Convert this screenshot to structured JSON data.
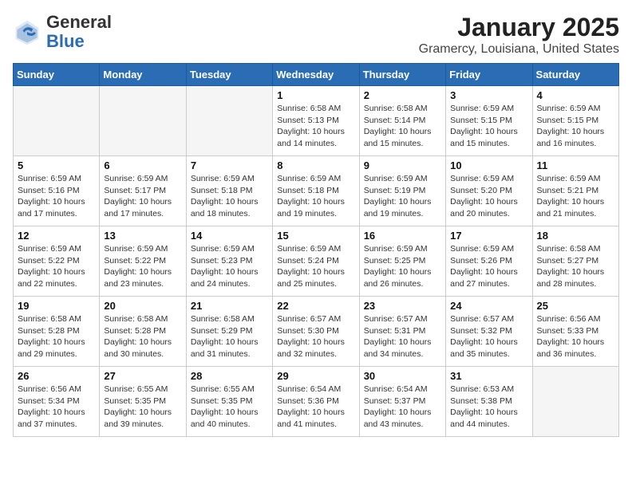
{
  "logo": {
    "general": "General",
    "blue": "Blue"
  },
  "title": "January 2025",
  "subtitle": "Gramercy, Louisiana, United States",
  "days_of_week": [
    "Sunday",
    "Monday",
    "Tuesday",
    "Wednesday",
    "Thursday",
    "Friday",
    "Saturday"
  ],
  "weeks": [
    [
      {
        "day": null,
        "info": null
      },
      {
        "day": null,
        "info": null
      },
      {
        "day": null,
        "info": null
      },
      {
        "day": "1",
        "sunrise": "6:58 AM",
        "sunset": "5:13 PM",
        "daylight": "10 hours and 14 minutes."
      },
      {
        "day": "2",
        "sunrise": "6:58 AM",
        "sunset": "5:14 PM",
        "daylight": "10 hours and 15 minutes."
      },
      {
        "day": "3",
        "sunrise": "6:59 AM",
        "sunset": "5:15 PM",
        "daylight": "10 hours and 15 minutes."
      },
      {
        "day": "4",
        "sunrise": "6:59 AM",
        "sunset": "5:15 PM",
        "daylight": "10 hours and 16 minutes."
      }
    ],
    [
      {
        "day": "5",
        "sunrise": "6:59 AM",
        "sunset": "5:16 PM",
        "daylight": "10 hours and 17 minutes."
      },
      {
        "day": "6",
        "sunrise": "6:59 AM",
        "sunset": "5:17 PM",
        "daylight": "10 hours and 17 minutes."
      },
      {
        "day": "7",
        "sunrise": "6:59 AM",
        "sunset": "5:18 PM",
        "daylight": "10 hours and 18 minutes."
      },
      {
        "day": "8",
        "sunrise": "6:59 AM",
        "sunset": "5:18 PM",
        "daylight": "10 hours and 19 minutes."
      },
      {
        "day": "9",
        "sunrise": "6:59 AM",
        "sunset": "5:19 PM",
        "daylight": "10 hours and 19 minutes."
      },
      {
        "day": "10",
        "sunrise": "6:59 AM",
        "sunset": "5:20 PM",
        "daylight": "10 hours and 20 minutes."
      },
      {
        "day": "11",
        "sunrise": "6:59 AM",
        "sunset": "5:21 PM",
        "daylight": "10 hours and 21 minutes."
      }
    ],
    [
      {
        "day": "12",
        "sunrise": "6:59 AM",
        "sunset": "5:22 PM",
        "daylight": "10 hours and 22 minutes."
      },
      {
        "day": "13",
        "sunrise": "6:59 AM",
        "sunset": "5:22 PM",
        "daylight": "10 hours and 23 minutes."
      },
      {
        "day": "14",
        "sunrise": "6:59 AM",
        "sunset": "5:23 PM",
        "daylight": "10 hours and 24 minutes."
      },
      {
        "day": "15",
        "sunrise": "6:59 AM",
        "sunset": "5:24 PM",
        "daylight": "10 hours and 25 minutes."
      },
      {
        "day": "16",
        "sunrise": "6:59 AM",
        "sunset": "5:25 PM",
        "daylight": "10 hours and 26 minutes."
      },
      {
        "day": "17",
        "sunrise": "6:59 AM",
        "sunset": "5:26 PM",
        "daylight": "10 hours and 27 minutes."
      },
      {
        "day": "18",
        "sunrise": "6:58 AM",
        "sunset": "5:27 PM",
        "daylight": "10 hours and 28 minutes."
      }
    ],
    [
      {
        "day": "19",
        "sunrise": "6:58 AM",
        "sunset": "5:28 PM",
        "daylight": "10 hours and 29 minutes."
      },
      {
        "day": "20",
        "sunrise": "6:58 AM",
        "sunset": "5:28 PM",
        "daylight": "10 hours and 30 minutes."
      },
      {
        "day": "21",
        "sunrise": "6:58 AM",
        "sunset": "5:29 PM",
        "daylight": "10 hours and 31 minutes."
      },
      {
        "day": "22",
        "sunrise": "6:57 AM",
        "sunset": "5:30 PM",
        "daylight": "10 hours and 32 minutes."
      },
      {
        "day": "23",
        "sunrise": "6:57 AM",
        "sunset": "5:31 PM",
        "daylight": "10 hours and 34 minutes."
      },
      {
        "day": "24",
        "sunrise": "6:57 AM",
        "sunset": "5:32 PM",
        "daylight": "10 hours and 35 minutes."
      },
      {
        "day": "25",
        "sunrise": "6:56 AM",
        "sunset": "5:33 PM",
        "daylight": "10 hours and 36 minutes."
      }
    ],
    [
      {
        "day": "26",
        "sunrise": "6:56 AM",
        "sunset": "5:34 PM",
        "daylight": "10 hours and 37 minutes."
      },
      {
        "day": "27",
        "sunrise": "6:55 AM",
        "sunset": "5:35 PM",
        "daylight": "10 hours and 39 minutes."
      },
      {
        "day": "28",
        "sunrise": "6:55 AM",
        "sunset": "5:35 PM",
        "daylight": "10 hours and 40 minutes."
      },
      {
        "day": "29",
        "sunrise": "6:54 AM",
        "sunset": "5:36 PM",
        "daylight": "10 hours and 41 minutes."
      },
      {
        "day": "30",
        "sunrise": "6:54 AM",
        "sunset": "5:37 PM",
        "daylight": "10 hours and 43 minutes."
      },
      {
        "day": "31",
        "sunrise": "6:53 AM",
        "sunset": "5:38 PM",
        "daylight": "10 hours and 44 minutes."
      },
      {
        "day": null,
        "info": null
      }
    ]
  ]
}
